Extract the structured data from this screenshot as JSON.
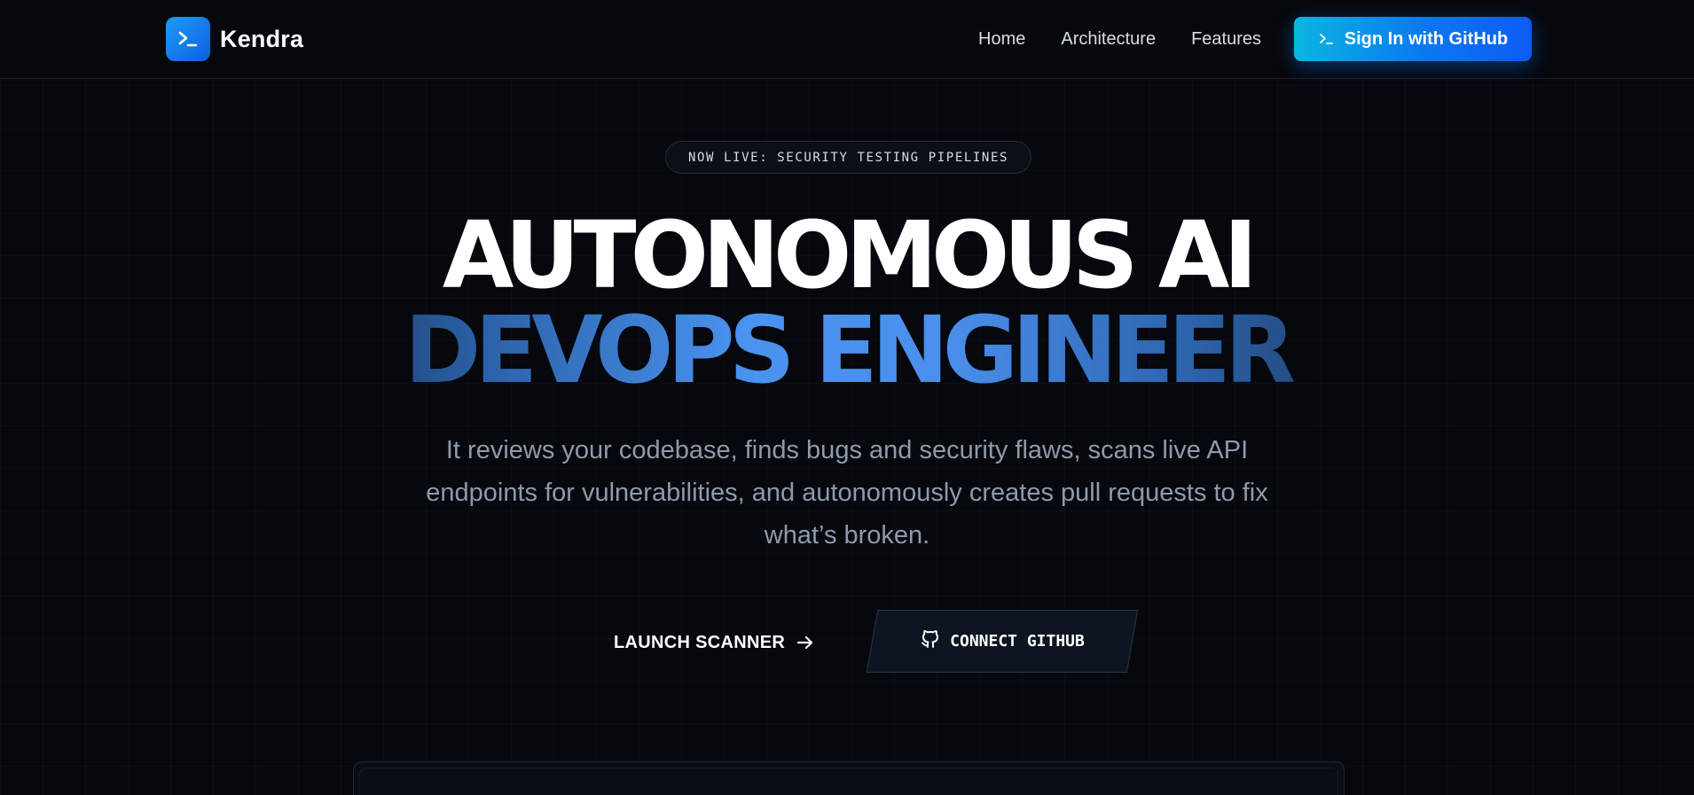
{
  "nav": {
    "brand": "Kendra",
    "links": [
      "Home",
      "Architecture",
      "Features"
    ],
    "signin_label": "Sign In with GitHub"
  },
  "hero": {
    "badge": "NOW LIVE: SECURITY TESTING PIPELINES",
    "title_line1": "AUTONOMOUS AI",
    "title_line2": "DEVOPS ENGINEER",
    "description": "It reviews your codebase, finds bugs and security flaws, scans live API endpoints for vulnerabilities, and autonomously creates pull requests to fix what’s broken.",
    "primary_cta": "LAUNCH SCANNER",
    "secondary_cta": "CONNECT GITHUB"
  },
  "colors": {
    "accent": "#0b78f0",
    "accent_cyan": "#08b6e0",
    "background": "#06080d"
  },
  "icons": {
    "logo": "terminal-prompt-icon",
    "signin": "terminal-prompt-icon",
    "launch": "arrow-right-icon",
    "connect": "github-icon"
  }
}
